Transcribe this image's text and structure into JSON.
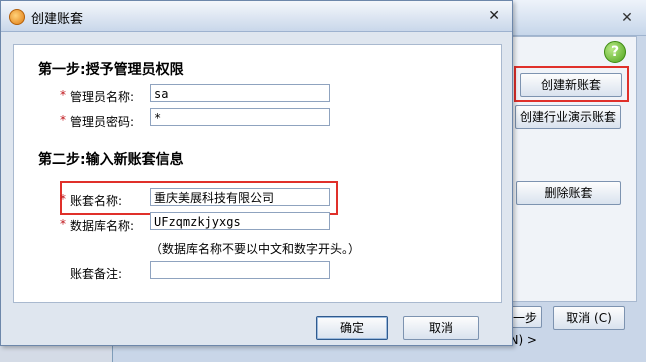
{
  "background_window": {
    "help_label": "?",
    "buttons": {
      "create_account": "创建新账套",
      "create_demo": "创建行业演示账套",
      "delete_account": "删除账套",
      "next": "下一步 (N) >",
      "cancel": "取消 (C)"
    }
  },
  "dialog": {
    "title": "创建账套",
    "close_label": "✕",
    "step1": {
      "heading": "第一步:授予管理员权限",
      "admin_name_label": "管理员名称:",
      "admin_name_value": "sa",
      "admin_password_label": "管理员密码:",
      "admin_password_value": "*"
    },
    "step2": {
      "heading": "第二步:输入新账套信息",
      "account_name_label": "账套名称:",
      "account_name_value": "重庆美展科技有限公司",
      "db_name_label": "数据库名称:",
      "db_name_value": "UFzqmzkjyxgs",
      "db_note": "（数据库名称不要以中文和数字开头。）",
      "remark_label": "账套备注:",
      "remark_value": ""
    },
    "required_mark": "*",
    "ok_label": "确定",
    "cancel_label": "取消"
  },
  "colors": {
    "highlight": "#e0302a",
    "required": "#c0161b"
  }
}
